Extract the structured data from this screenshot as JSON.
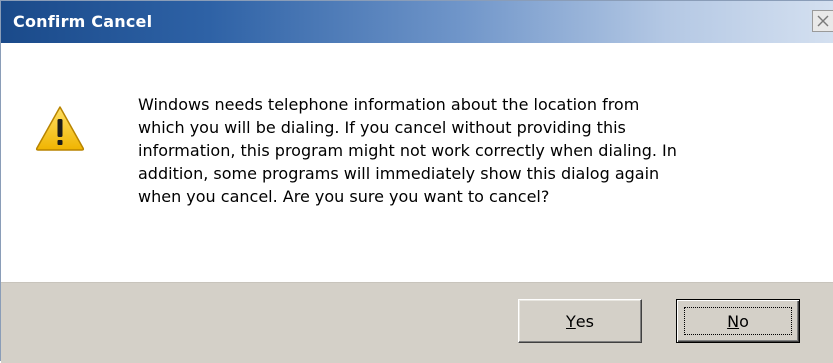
{
  "window": {
    "title": "Confirm Cancel",
    "close_glyph": "✕"
  },
  "icon": {
    "name": "warning-icon",
    "glyph": "!",
    "fill_color": "#f5c518",
    "border_color": "#c08a00"
  },
  "message": {
    "lines": [
      "Windows needs telephone information about the location from",
      "which you will be dialing. If you cancel without providing this",
      "information, this program might not work correctly when dialing. In",
      "addition, some programs will immediately show this dialog again",
      "when you cancel. Are you sure you want to cancel?"
    ]
  },
  "buttons": {
    "yes": {
      "accel": "Y",
      "rest": "es"
    },
    "no": {
      "accel": "N",
      "rest": "o"
    }
  },
  "colors": {
    "title_start": "#1a4a8a",
    "title_end": "#d4e0f0",
    "footer_bg": "#d4d0c8"
  }
}
